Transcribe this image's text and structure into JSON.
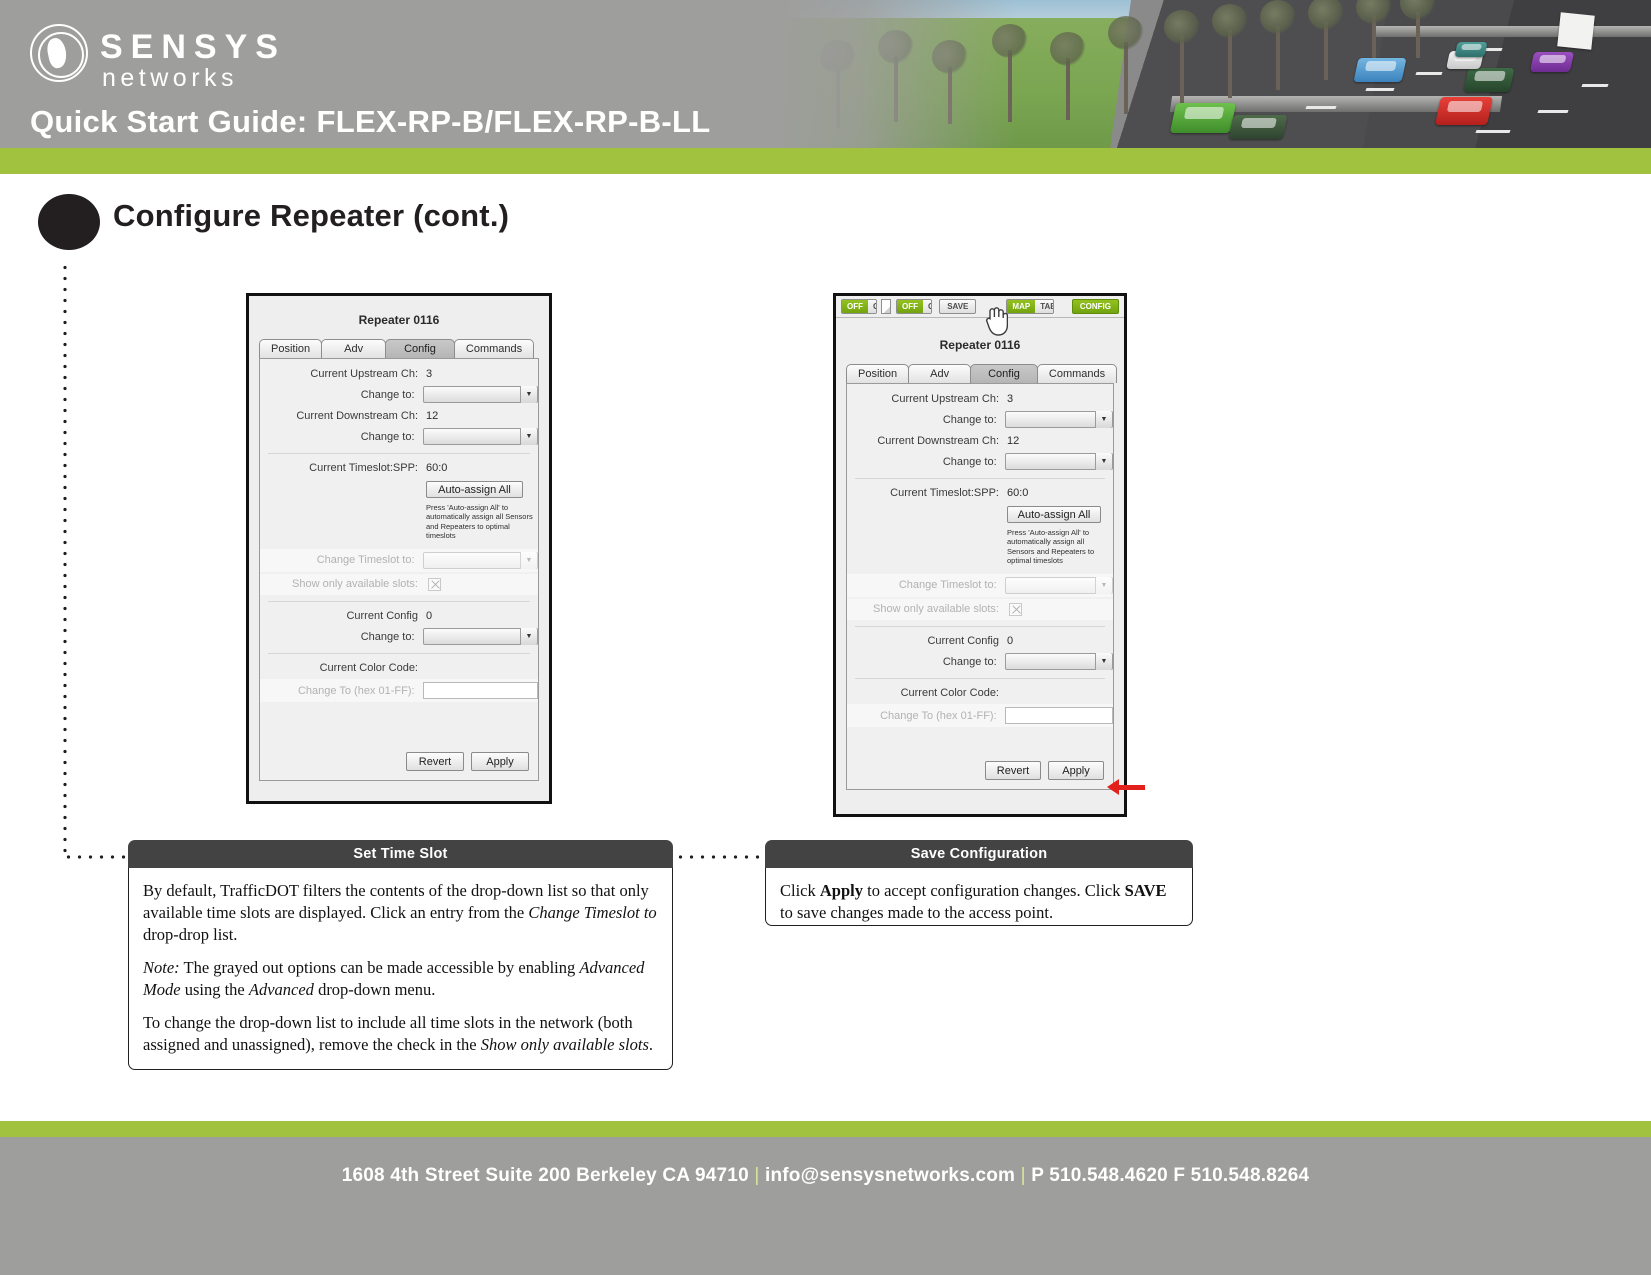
{
  "header": {
    "logo_primary": "SENSYS",
    "logo_secondary": "networks",
    "title": "Quick Start Guide: FLEX-RP-B/FLEX-RP-B-LL",
    "accent_green": "#a0c23e",
    "band_gray": "#9e9e9c"
  },
  "section": {
    "title": "Configure Repeater (cont.)"
  },
  "left_panel": {
    "window_title": "Repeater 0116",
    "tabs": [
      {
        "label": "Position",
        "active": false
      },
      {
        "label": "Adv",
        "active": false
      },
      {
        "label": "Config",
        "active": true
      },
      {
        "label": "Commands",
        "active": false
      }
    ],
    "fields": {
      "upstream_label": "Current Upstream Ch:",
      "upstream_value": "3",
      "upstream_change_label": "Change to:",
      "upstream_change_value": "",
      "downstream_label": "Current Downstream Ch:",
      "downstream_value": "12",
      "downstream_change_label": "Change to:",
      "downstream_change_value": "",
      "timeslot_label": "Current Timeslot:SPP:",
      "timeslot_value": "60:0",
      "auto_assign_button": "Auto-assign All",
      "auto_assign_hint": "Press 'Auto-assign All' to automatically assign all Sensors and Repeaters to optimal timeslots",
      "change_timeslot_label": "Change Timeslot to:",
      "change_timeslot_value": "",
      "show_available_label": "Show only available slots:",
      "show_available_checked": true,
      "config_label": "Current Config",
      "config_value": "0",
      "config_change_label": "Change to:",
      "config_change_value": "",
      "color_code_label": "Current Color Code:",
      "color_code_value": "",
      "color_change_label": "Change To (hex 01-FF):",
      "color_change_value": ""
    },
    "buttons": {
      "revert": "Revert",
      "apply": "Apply"
    }
  },
  "right_panel": {
    "toolbar": {
      "toggle1": {
        "off": "OFF",
        "on": "ON",
        "active": "off"
      },
      "page_icon": "page-icon",
      "toggle2": {
        "off": "OFF",
        "on": "ON",
        "active": "off"
      },
      "save": "SAVE",
      "map": "MAP",
      "table": "TABLE",
      "config": "CONFIG",
      "cursor": "hand-cursor"
    },
    "window_title": "Repeater 0116",
    "tabs": [
      {
        "label": "Position",
        "active": false
      },
      {
        "label": "Adv",
        "active": false
      },
      {
        "label": "Config",
        "active": true
      },
      {
        "label": "Commands",
        "active": false
      }
    ],
    "fields": {
      "upstream_label": "Current Upstream Ch:",
      "upstream_value": "3",
      "upstream_change_label": "Change to:",
      "upstream_change_value": "",
      "downstream_label": "Current Downstream Ch:",
      "downstream_value": "12",
      "downstream_change_label": "Change to:",
      "downstream_change_value": "",
      "timeslot_label": "Current Timeslot:SPP:",
      "timeslot_value": "60:0",
      "auto_assign_button": "Auto-assign All",
      "auto_assign_hint": "Press 'Auto-assign All' to automatically assign all Sensors and Repeaters to optimal timeslots",
      "change_timeslot_label": "Change Timeslot to:",
      "change_timeslot_value": "",
      "show_available_label": "Show only available slots:",
      "show_available_checked": true,
      "config_label": "Current Config",
      "config_value": "0",
      "config_change_label": "Change to:",
      "config_change_value": "",
      "color_code_label": "Current Color Code:",
      "color_code_value": "",
      "color_change_label": "Change To (hex 01-FF):",
      "color_change_value": ""
    },
    "buttons": {
      "revert": "Revert",
      "apply": "Apply"
    },
    "annotation_arrow_color": "#e2211c"
  },
  "callouts": [
    {
      "title": "Set Time Slot",
      "paragraphs": [
        {
          "parts": [
            {
              "t": "By default, TrafficDOT filters the contents of the drop-down list so that only available time slots are displayed. Click an entry from the ",
              "style": "normal"
            },
            {
              "t": "Change Timeslot to",
              "style": "italic"
            },
            {
              "t": " drop-drop list.",
              "style": "normal"
            }
          ]
        },
        {
          "parts": [
            {
              "t": "Note:",
              "style": "italic"
            },
            {
              "t": " The grayed out options can be made accessible by enabling ",
              "style": "normal"
            },
            {
              "t": "Advanced Mode",
              "style": "italic"
            },
            {
              "t": " using the ",
              "style": "normal"
            },
            {
              "t": "Advanced",
              "style": "italic"
            },
            {
              "t": " drop-down menu.",
              "style": "normal"
            }
          ]
        },
        {
          "parts": [
            {
              "t": "To change the drop-down list to include all time slots in the network (both assigned and unassigned), remove the check in the ",
              "style": "normal"
            },
            {
              "t": "Show only available slots",
              "style": "italic"
            },
            {
              "t": ".",
              "style": "normal"
            }
          ]
        }
      ]
    },
    {
      "title": "Save Configuration",
      "paragraphs": [
        {
          "parts": [
            {
              "t": "Click ",
              "style": "normal"
            },
            {
              "t": "Apply",
              "style": "bold"
            },
            {
              "t": " to accept configuration changes. Click ",
              "style": "normal"
            },
            {
              "t": "SAVE",
              "style": "bold"
            },
            {
              "t": " to save changes made to the access point.",
              "style": "normal"
            }
          ]
        }
      ]
    }
  ],
  "footer": {
    "address": "1608 4th Street Suite 200 Berkeley CA 94710",
    "email": "info@sensysnetworks.com",
    "phone": "P 510.548.4620 F 510.548.8264",
    "separator": "|"
  }
}
